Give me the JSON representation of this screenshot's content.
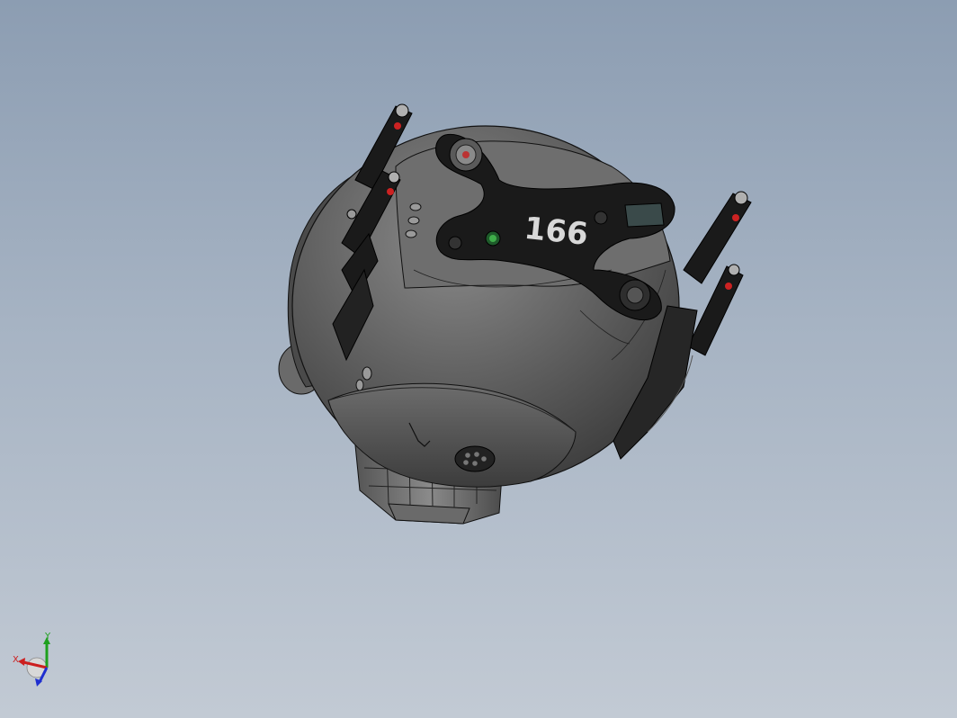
{
  "viewport": {
    "background_top": "#8c9db2",
    "background_bottom": "#c2cad4"
  },
  "model": {
    "body_color": "#5a5a5a",
    "panel_color": "#1a1a1a",
    "unit_number": "166",
    "unit_number_color": "#d8d8d8"
  },
  "triad": {
    "x_label": "X",
    "y_label": "Y",
    "x_color": "#cc1f1f",
    "y_color": "#1ea01e",
    "z_color": "#1f2fd0"
  }
}
